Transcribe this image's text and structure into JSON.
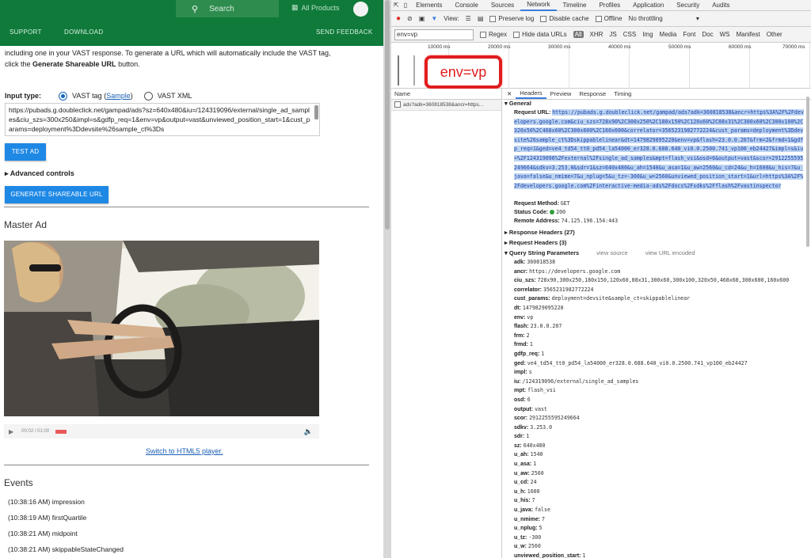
{
  "header": {
    "search_label": "Search",
    "all_products": "All Products",
    "nav": [
      "SUPPORT",
      "DOWNLOAD",
      "SEND FEEDBACK"
    ]
  },
  "intro": {
    "line1": "including one in your VAST response. To generate a URL which will automatically include the VAST tag,",
    "line2_pre": "click the ",
    "line2_bold": "Generate Shareable URL",
    "line2_post": " button."
  },
  "input_type": {
    "label": "Input type:",
    "option1": "VAST tag (",
    "option1_link": "Sample",
    "option1_close": ")",
    "option2": "VAST XML"
  },
  "vast_url": "https://pubads.g.doubleclick.net/gampad/ads?sz=640x480&iu=/124319096/external/single_ad_samples&ciu_szs=300x250&impl=s&gdfp_req=1&env=vp&output=vast&unviewed_position_start=1&cust_params=deployment%3Ddevsite%26sample_ct%3Ds",
  "buttons": {
    "test_ad": "TEST AD",
    "advanced": "Advanced controls",
    "generate": "GENERATE SHAREABLE URL"
  },
  "master_ad": {
    "title": "Master Ad",
    "time": "00:02 / 01:00",
    "switch_link": "Switch to HTML5 player."
  },
  "events": {
    "title": "Events",
    "items": [
      "(10:38:16 AM) impression",
      "(10:38:19 AM) firstQuartile",
      "(10:38:21 AM) midpoint",
      "(10:38:21 AM) skippableStateChanged"
    ]
  },
  "devtools": {
    "tabs": [
      "Elements",
      "Console",
      "Sources",
      "Network",
      "Timeline",
      "Profiles",
      "Application",
      "Security",
      "Audits"
    ],
    "active_tab": "Network",
    "toolbar": {
      "view": "View:",
      "preserve_log": "Preserve log",
      "disable_cache": "Disable cache",
      "offline": "Offline",
      "throttling": "No throttling"
    },
    "filter": {
      "value": "env=vp",
      "regex": "Regex",
      "hide_data_urls": "Hide data URLs",
      "types": [
        "All",
        "XHR",
        "JS",
        "CSS",
        "Img",
        "Media",
        "Font",
        "Doc",
        "WS",
        "Manifest",
        "Other"
      ]
    },
    "timeline_ticks": [
      "10000 ms",
      "20000 ms",
      "30000 ms",
      "40000 ms",
      "50000 ms",
      "60000 ms",
      "70000 ms"
    ],
    "callout": "env=vp",
    "name_header": "Name",
    "request_name": "ads?adk=360818538&ancr=https...",
    "detail_tabs": [
      "Headers",
      "Preview",
      "Response",
      "Timing"
    ],
    "active_detail_tab": "Headers",
    "general_label": "General",
    "request_url_label": "Request URL:",
    "request_url": "https://pubads.g.doubleclick.net/gampad/ads?adk=360818538&ancr=https%3A%2F%2Fdevelopers.google.com&ciu_szs=728x90%2C300x250%2C180x150%2C120x60%2C88x31%2C300x60%2C300x100%2C320x50%2C468x60%2C300x600%2C160x600&correlator=3565231982772224&cust_params=deployment%3Ddevsite%26sample_ct%3Dskippablelinear&dt=1479829095220&env=vp&flash=23.0.0.207&frm=2&frmd=1&gdfp_req=1&ged=ve4_td54_tt0_pd54_la54000_er328.0.688.640_vi0.0.2500.741_vp100_eb24427&impl=s&iu=%2F124319096%2Fexternal%2Fsingle_ad_samples&mpt=flash_vsi&osd=6&output=vast&scor=2912255595249664&sdkv=3.253.0&sdr=1&sz=640x480&u_ah=1540&u_asa=1&u_aw=2560&u_cd=24&u_h=1600&u_his=7&u_java=false&u_nmime=7&u_nplug=5&u_tz=-300&u_w=2560&unviewed_position_start=1&url=https%3A%2F%2Fdevelopers.google.com%2Finteractive-media-ads%2Fdocs%2Fsdks%2Fflash%2Fvastinspector",
    "request_method_label": "Request Method:",
    "request_method": "GET",
    "status_code_label": "Status Code:",
    "status_code": "200",
    "remote_address_label": "Remote Address:",
    "remote_address": "74.125.196.154:443",
    "response_headers": "Response Headers (27)",
    "request_headers": "Request Headers (3)",
    "query_params_label": "Query String Parameters",
    "view_source": "view source",
    "view_url_encoded": "view URL encoded",
    "params": [
      {
        "k": "adk:",
        "v": "360818538"
      },
      {
        "k": "ancr:",
        "v": "https://developers.google.com"
      },
      {
        "k": "ciu_szs:",
        "v": "728x90,300x250,180x150,120x60,88x31,300x60,300x100,320x50,468x60,300x600,160x600"
      },
      {
        "k": "correlator:",
        "v": "3565231982772224"
      },
      {
        "k": "cust_params:",
        "v": "deployment=devsite&sample_ct=skippablelinear"
      },
      {
        "k": "dt:",
        "v": "1479829095220"
      },
      {
        "k": "env:",
        "v": "vp"
      },
      {
        "k": "flash:",
        "v": "23.0.0.207"
      },
      {
        "k": "frm:",
        "v": "2"
      },
      {
        "k": "frmd:",
        "v": "1"
      },
      {
        "k": "gdfp_req:",
        "v": "1"
      },
      {
        "k": "ged:",
        "v": "ve4_td54_tt0_pd54_la54000_er328.0.688.640_vi0.0.2500.741_vp100_eb24427"
      },
      {
        "k": "impl:",
        "v": "s"
      },
      {
        "k": "iu:",
        "v": "/124319096/external/single_ad_samples"
      },
      {
        "k": "mpt:",
        "v": "flash_vsi"
      },
      {
        "k": "osd:",
        "v": "6"
      },
      {
        "k": "output:",
        "v": "vast"
      },
      {
        "k": "scor:",
        "v": "2912255595249664"
      },
      {
        "k": "sdkv:",
        "v": "3.253.0"
      },
      {
        "k": "sdr:",
        "v": "1"
      },
      {
        "k": "sz:",
        "v": "640x480"
      },
      {
        "k": "u_ah:",
        "v": "1540"
      },
      {
        "k": "u_asa:",
        "v": "1"
      },
      {
        "k": "u_aw:",
        "v": "2560"
      },
      {
        "k": "u_cd:",
        "v": "24"
      },
      {
        "k": "u_h:",
        "v": "1600"
      },
      {
        "k": "u_his:",
        "v": "7"
      },
      {
        "k": "u_java:",
        "v": "false"
      },
      {
        "k": "u_nmime:",
        "v": "7"
      },
      {
        "k": "u_nplug:",
        "v": "5"
      },
      {
        "k": "u_tz:",
        "v": "-300"
      },
      {
        "k": "u_w:",
        "v": "2560"
      },
      {
        "k": "unviewed_position_start:",
        "v": "1"
      }
    ]
  },
  "colors": {
    "header_green": "#0f7a3a",
    "button_blue": "#1e88e5",
    "callout_red": "#e01d1d"
  }
}
